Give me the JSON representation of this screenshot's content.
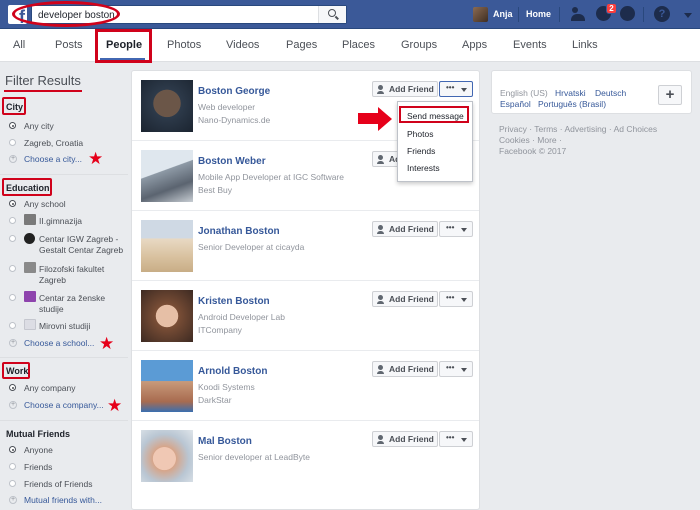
{
  "search": {
    "value": "developer boston"
  },
  "topbar": {
    "user": "Anja",
    "home": "Home",
    "notification_count": "2"
  },
  "tabs": [
    "All",
    "Posts",
    "People",
    "Photos",
    "Videos",
    "Pages",
    "Places",
    "Groups",
    "Apps",
    "Events",
    "Links"
  ],
  "filter": {
    "title": "Filter Results",
    "city": {
      "title": "City",
      "options": [
        "Any city",
        "Zagreb, Croatia"
      ],
      "choose": "Choose a city..."
    },
    "education": {
      "title": "Education",
      "options": [
        "Any school",
        "II.gimnazija",
        "Centar IGW Zagreb -",
        "Gestalt Centar Zagreb",
        "Filozofski fakultet",
        "Zagreb",
        "Centar za ženske",
        "studije",
        "Mirovni studiji"
      ],
      "choose": "Choose a school..."
    },
    "work": {
      "title": "Work",
      "options": [
        "Any company"
      ],
      "choose": "Choose a company..."
    },
    "mutual": {
      "title": "Mutual Friends",
      "options": [
        "Anyone",
        "Friends",
        "Friends of Friends"
      ],
      "choose": "Mutual friends with..."
    }
  },
  "results": [
    {
      "name": "Boston George",
      "line1": "Web developer",
      "line2": "Nano-Dynamics.de"
    },
    {
      "name": "Boston Weber",
      "line1": "Mobile App Developer at IGC Software",
      "line2": "Best Buy"
    },
    {
      "name": "Jonathan Boston",
      "line1": "Senior Developer at cicayda",
      "line2": ""
    },
    {
      "name": "Kristen Boston",
      "line1": "Android Developer Lab",
      "line2": "ITCompany"
    },
    {
      "name": "Arnold Boston",
      "line1": "Koodi Systems",
      "line2": "DarkStar"
    },
    {
      "name": "Mal Boston",
      "line1": "Senior developer at LeadByte",
      "line2": ""
    }
  ],
  "buttons": {
    "add_friend": "Add Friend",
    "more": "•••"
  },
  "dropdown": [
    "Send message",
    "Photos",
    "Friends",
    "Interests"
  ],
  "languages": {
    "current": "English (US)",
    "l2": "Hrvatski",
    "l3": "Deutsch",
    "l4": "Español",
    "l5": "Português (Brasil)"
  },
  "footer": {
    "line1": "Privacy · Terms · Advertising · Ad Choices",
    "line2": "Cookies · More ·",
    "line3": "Facebook © 2017"
  },
  "colors": {
    "brand": "#3b5998",
    "annotation": "#d0021b",
    "link": "#365899"
  }
}
